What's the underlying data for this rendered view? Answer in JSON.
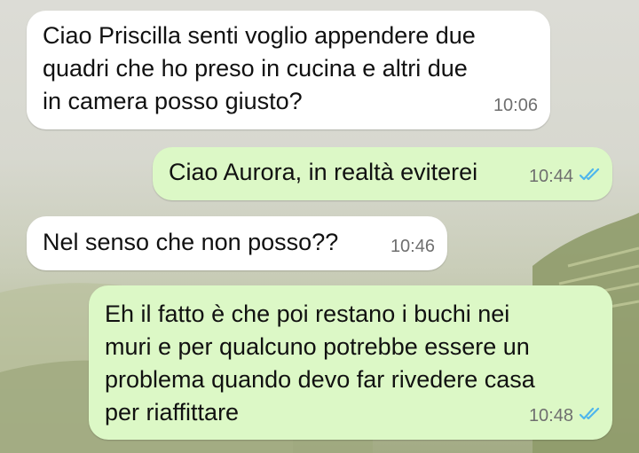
{
  "chat": {
    "messages": [
      {
        "direction": "incoming",
        "text": "Ciao Priscilla senti voglio appendere due\nquadri che ho preso in cucina e altri due\nin camera posso giusto?",
        "time": "10:06"
      },
      {
        "direction": "outgoing",
        "text": "Ciao Aurora, in realtà eviterei",
        "time": "10:44",
        "status": "read"
      },
      {
        "direction": "incoming",
        "text": "Nel senso che non posso??",
        "time": "10:46"
      },
      {
        "direction": "outgoing",
        "text": "Eh il fatto è che poi restano i buchi nei\nmuri e per qualcuno potrebbe essere un\nproblema quando devo far rivedere casa\nper riaffittare",
        "time": "10:48",
        "status": "read"
      }
    ]
  },
  "colors": {
    "incoming_bubble": "#ffffff",
    "outgoing_bubble": "#dcf8c6",
    "read_ticks": "#4fb6ec",
    "timestamp": "#6f6f6f"
  },
  "icons": {
    "read_receipt": "double-check-icon"
  }
}
